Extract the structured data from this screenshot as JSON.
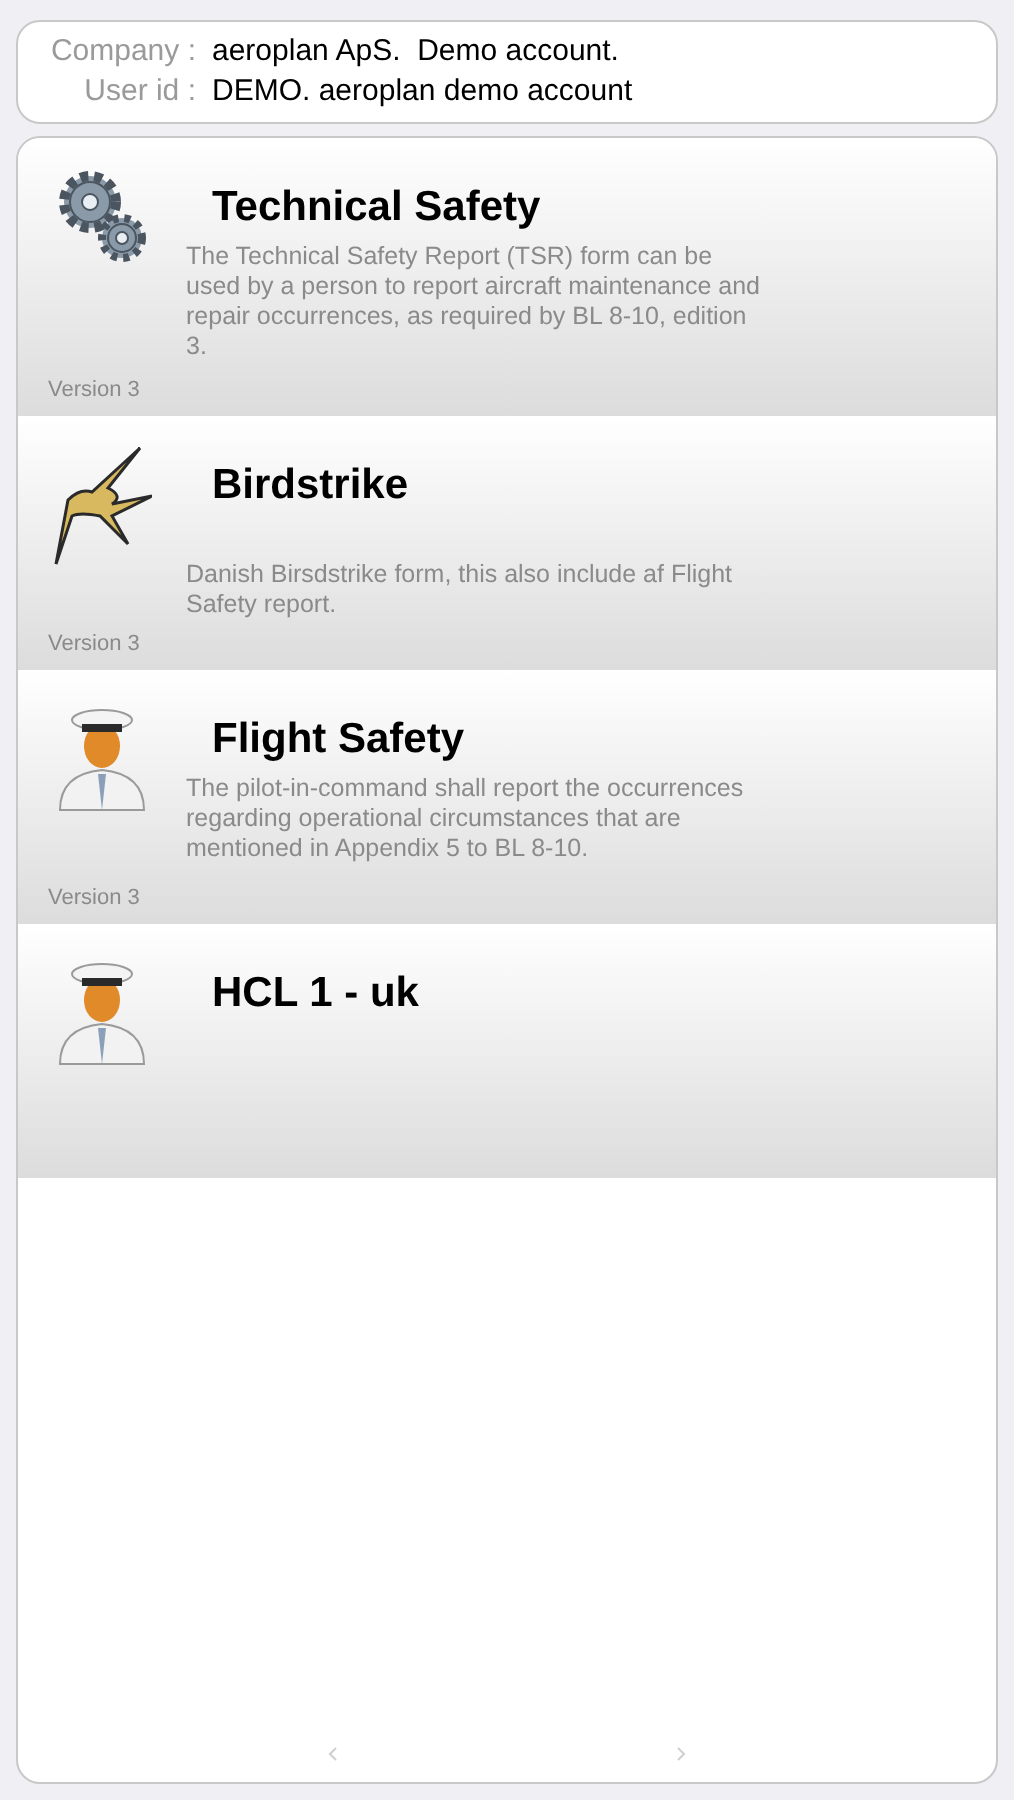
{
  "account": {
    "fields": [
      {
        "label": "Company :",
        "value": "aeroplan ApS.  Demo account."
      },
      {
        "label": "User id :",
        "value": "DEMO. aeroplan demo account"
      }
    ]
  },
  "forms": [
    {
      "kind": "gears",
      "title": "Technical Safety",
      "description": "The Technical Safety Report (TSR) form can be used by a person to report aircraft maintenance and repair occurrences, as required by BL 8-10, edition 3.",
      "version": "Version 3"
    },
    {
      "kind": "bird",
      "title": "Birdstrike",
      "description": "Danish Birsdstrike form, this also include af Flight Safety report.",
      "version": "Version 3"
    },
    {
      "kind": "pilot",
      "title": "Flight Safety",
      "description": "The pilot-in-command shall report the occurrences regarding operational circumstances that are mentioned in Appendix 5 to BL 8-10.",
      "version": "Version 3"
    },
    {
      "kind": "pilot",
      "title": "HCL 1 - uk"
    }
  ]
}
